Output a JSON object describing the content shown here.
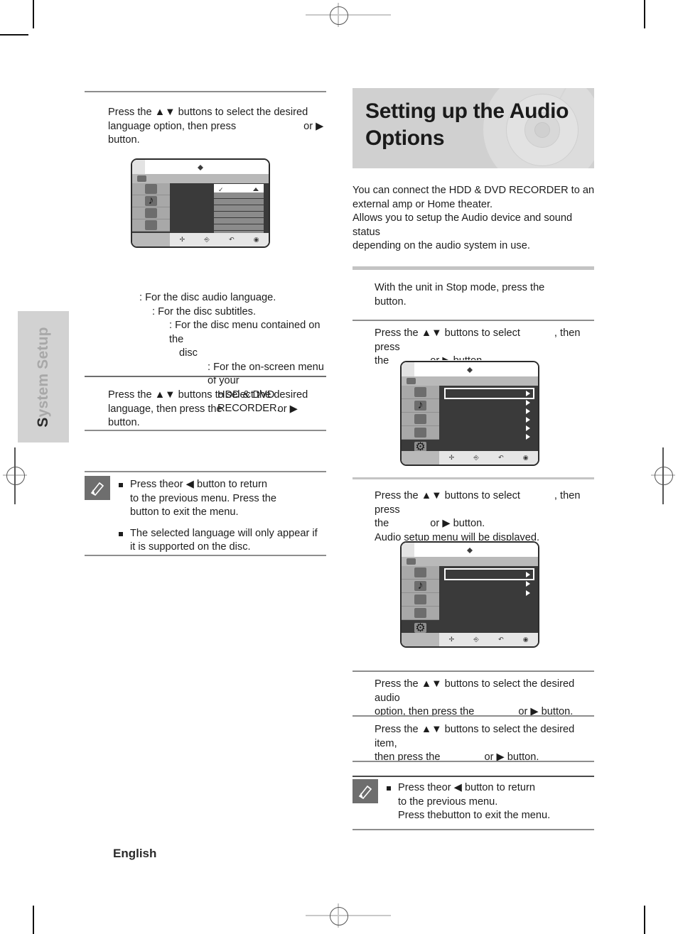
{
  "page": {
    "chapter_tab": {
      "cap": "S",
      "rest": "ystem Setup"
    },
    "footer_language": "English"
  },
  "left_column": {
    "step_language_option": {
      "text_1": "Press the ▲▼ buttons to select the desired",
      "text_2": "language option, then press",
      "text_3": "or ▶ button."
    },
    "legend": [
      {
        "prefix": "",
        "text": ": For the disc audio language."
      },
      {
        "prefix": "",
        "text": ": For the disc subtitles."
      },
      {
        "prefix": "",
        "text": ": For the disc menu contained on the"
      },
      {
        "prefix": "",
        "text": "disc"
      },
      {
        "prefix": "",
        "text": ": For the on-screen menu of your"
      },
      {
        "prefix": "",
        "text": "HDD & DVD RECORDER."
      }
    ],
    "step_language_select": {
      "text_1": "Press the ▲▼ buttons to select the desired",
      "text_2": "language, then press the",
      "text_3": "or ▶ button."
    },
    "note": {
      "icon": "pencil-icon",
      "items": [
        {
          "line_1a": "Press the",
          "line_1b": "or ◀ button to return",
          "line_2": "to the previous menu. Press the",
          "line_3": "button to exit the menu."
        },
        {
          "line_1a": "The selected language will only appear if",
          "line_2": "it is supported on the disc."
        }
      ]
    },
    "osd_language": {
      "name": "language-options-menu",
      "selected_sidebar_index": 4,
      "sidebar_icons": [
        "tab-icon",
        "film-icon",
        "music-note-icon",
        "display-icon",
        "disc-clock-icon",
        "gear-icon"
      ],
      "list_rows": 8,
      "highlighted_row": 0,
      "highlight_check": "✓",
      "scroll_up": true,
      "scroll_down": true,
      "bottom_icons": [
        "move-icon",
        "select-icon",
        "return-icon",
        "exit-icon"
      ]
    }
  },
  "right_column": {
    "title": "Setting up the Audio Options",
    "intro": [
      "You can connect the HDD & DVD RECORDER to an",
      "external amp or Home theater.",
      "Allows you to setup the Audio device and sound status",
      "depending on the audio system in use."
    ],
    "step_1": {
      "text_1": "With the unit in Stop mode, press the",
      "text_2": "button."
    },
    "step_2": {
      "text_1a": "Press the ▲▼ buttons to select",
      "text_1b": ", then press",
      "text_2a": "the",
      "text_2b": "or ▶ button."
    },
    "step_3": {
      "text_1a": "Press the ▲▼ buttons to select",
      "text_1b": ", then press",
      "text_2a": "the",
      "text_2b": "or ▶ button.",
      "text_3": "Audio setup menu will be displayed."
    },
    "step_4": {
      "text_1": "Press the ▲▼ buttons to select the desired audio",
      "text_2a": "option, then press the",
      "text_2b": "or ▶ button."
    },
    "step_5": {
      "text_1": "Press the ▲▼ buttons to select the desired item,",
      "text_2a": "then press the",
      "text_2b": "or ▶ button."
    },
    "note": {
      "icon": "pencil-icon",
      "items": [
        {
          "line_1a": "Press the",
          "line_1b": "or ◀ button to return",
          "line_2": "to the previous menu.",
          "line_3a": "Press the",
          "line_3b": "button to exit the menu."
        }
      ]
    },
    "osd_setup": {
      "name": "setup-menu",
      "selected_sidebar_index": 5,
      "list_rows": 6,
      "highlighted_row": 0,
      "sidebar_icons": [
        "tab-icon",
        "film-icon",
        "music-note-icon",
        "display-icon",
        "disc-clock-icon",
        "gear-icon"
      ],
      "bottom_icons": [
        "move-icon",
        "select-icon",
        "return-icon",
        "exit-icon"
      ]
    },
    "osd_audio": {
      "name": "audio-setup-menu",
      "selected_sidebar_index": 5,
      "list_rows": 3,
      "highlighted_row": 0,
      "sidebar_icons": [
        "tab-icon",
        "film-icon",
        "music-note-icon",
        "display-icon",
        "disc-clock-icon",
        "gear-icon"
      ],
      "bottom_icons": [
        "move-icon",
        "select-icon",
        "return-icon",
        "exit-icon"
      ]
    }
  },
  "colors": {
    "banner_bg": "#d0d0d0",
    "tab_bg": "#d2d2d2",
    "osd_dark": "#3a3a3a",
    "osd_row": "#8b8b8b"
  }
}
